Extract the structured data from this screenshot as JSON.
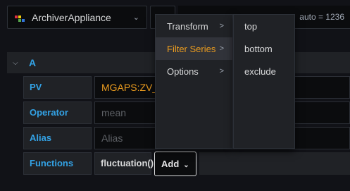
{
  "datasource": {
    "name": "ArchiverAppliance"
  },
  "query_info": "auto = 1236",
  "query": {
    "ref_id": "A",
    "pv": {
      "label": "PV",
      "value": "MGAPS:ZV_S"
    },
    "operator": {
      "label": "Operator",
      "placeholder": "mean"
    },
    "alias": {
      "label": "Alias",
      "placeholder": "Alias"
    },
    "functions": {
      "label": "Functions",
      "items": [
        "fluctuation()"
      ],
      "add_label": "Add"
    }
  },
  "menu": {
    "items": [
      {
        "label": "Transform",
        "arrow": ">"
      },
      {
        "label": "Filter Series",
        "arrow": ">"
      },
      {
        "label": "Options",
        "arrow": ">"
      }
    ],
    "submenu": [
      "top",
      "bottom",
      "exclude"
    ]
  },
  "colors": {
    "accent": "#eb9c1f",
    "label_blue": "#33a2e5"
  }
}
